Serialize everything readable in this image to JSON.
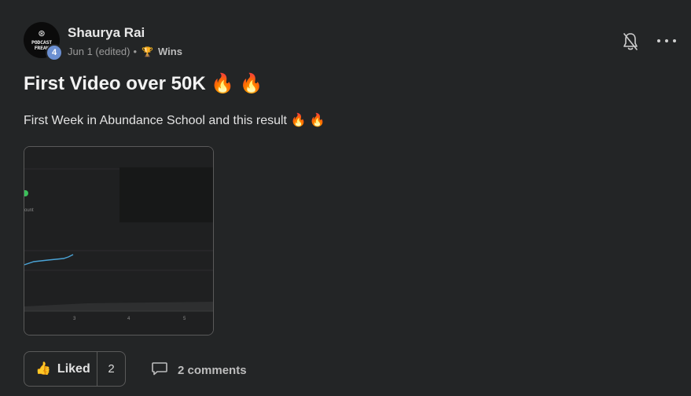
{
  "author": {
    "name": "Shaurya Rai",
    "avatar_text": "PODCAST FREAK",
    "level": "4"
  },
  "meta": {
    "date": "Jun 1 (edited)",
    "separator": "•",
    "category_icon": "🏆",
    "category": "Wins"
  },
  "post": {
    "title": "First Video over 50K 🔥 🔥",
    "body": "First Week in Abundance School and this result 🔥 🔥"
  },
  "thumbnail": {
    "label_fragment": "ount",
    "x_ticks": [
      "3",
      "4",
      "5"
    ],
    "colors": {
      "line": "#4aa3d6",
      "marker": "#3bbf5a"
    }
  },
  "actions": {
    "like_icon": "👍",
    "like_label": "Liked",
    "like_count": "2",
    "comments_label": "2 comments"
  },
  "icons": {
    "bell": "bell-off-icon",
    "more": "more-horizontal-icon",
    "comment": "comment-icon",
    "like": "thumbs-up-icon",
    "trophy": "trophy-icon"
  }
}
